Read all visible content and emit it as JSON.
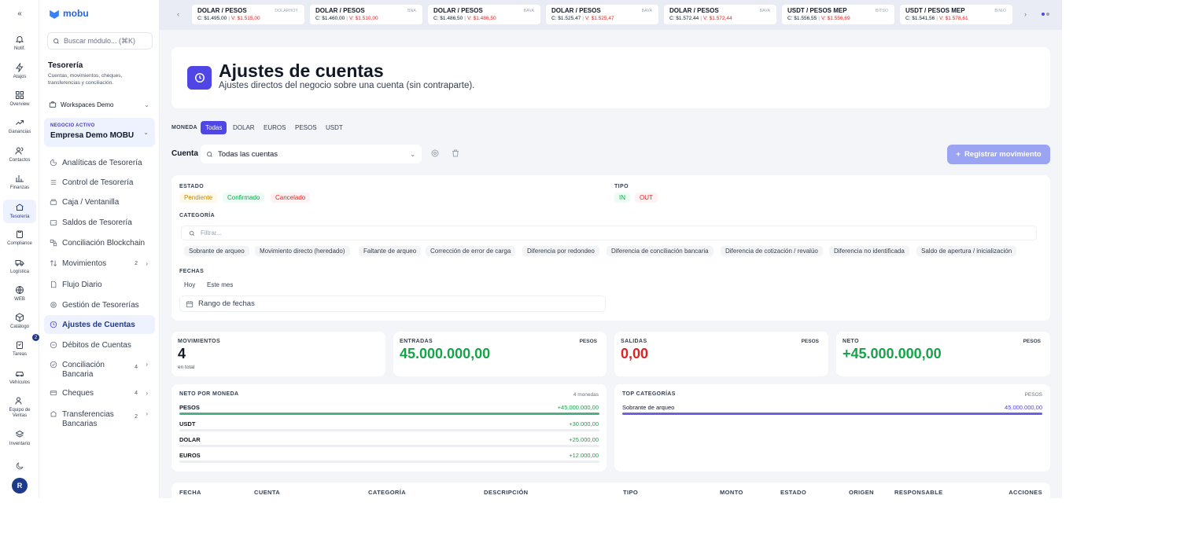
{
  "sidebar": {
    "brand": "mobu",
    "search_placeholder": "Buscar módulo... (⌘K)",
    "section_title": "Tesorería",
    "section_desc": "Cuentas, movimientos, cheques, transferencias y conciliación.",
    "workspace": "Workspaces Demo",
    "business_label": "NEGOCIO ACTIVO",
    "business_name": "Empresa Demo MOBU",
    "items": [
      {
        "label": "Analíticas de Tesorería"
      },
      {
        "label": "Control de Tesorería"
      },
      {
        "label": "Caja / Ventanilla"
      },
      {
        "label": "Saldos de Tesorería"
      },
      {
        "label": "Conciliación Blockchain"
      },
      {
        "label": "Movimientos",
        "count": "2"
      },
      {
        "label": "Flujo Diario"
      },
      {
        "label": "Gestión de Tesorerías"
      },
      {
        "label": "Ajustes de Cuentas"
      },
      {
        "label": "Débitos de Cuentas"
      },
      {
        "label": "Conciliación Bancaria",
        "count": "4"
      },
      {
        "label": "Cheques",
        "count": "4"
      },
      {
        "label": "Transferencias Bancarias",
        "count": "2"
      }
    ]
  },
  "rail": {
    "items": [
      "Notif.",
      "Atajos",
      "Overview",
      "Ganancias",
      "Contactos",
      "Finanzas",
      "Tesorería",
      "Compliance",
      "Logística",
      "WEB",
      "Catálogo",
      "Tareas",
      "Vehículos",
      "Equipo de Ventas",
      "Inventario"
    ],
    "tasks_badge": "2",
    "avatar": "R"
  },
  "ticker": [
    {
      "name": "DOLAR / PESOS",
      "source": "DOLARHOY",
      "buy": "C: $1.495,00",
      "sell": "V: $1.515,00"
    },
    {
      "name": "DOLAR / PESOS",
      "source": "BNA",
      "buy": "C: $1.460,00",
      "sell": "V: $1.510,00"
    },
    {
      "name": "DOLAR / PESOS",
      "source": "BAVA",
      "buy": "C: $1.486,50",
      "sell": "V: $1.486,50"
    },
    {
      "name": "DOLAR / PESOS",
      "source": "BAVA",
      "buy": "C: $1.525,47",
      "sell": "V: $1.525,47"
    },
    {
      "name": "DOLAR / PESOS",
      "source": "BAVA",
      "buy": "C: $1.572,44",
      "sell": "V: $1.572,44"
    },
    {
      "name": "USDT / PESOS MEP",
      "source": "BITSO",
      "buy": "C: $1.556,55",
      "sell": "V: $1.556,69"
    },
    {
      "name": "USDT / PESOS MEP",
      "source": "BINIO",
      "buy": "C: $1.541,56",
      "sell": "V: $1.578,61"
    }
  ],
  "hero": {
    "title": "Ajustes de cuentas",
    "subtitle": "Ajustes directos del negocio sobre una cuenta (sin contraparte)."
  },
  "currency": {
    "label": "MONEDA",
    "options": [
      "Todas",
      "DOLAR",
      "EUROS",
      "PESOS",
      "USDT"
    ]
  },
  "account": {
    "label": "Cuenta",
    "value": "Todas las cuentas",
    "register_label": "Registrar movimiento"
  },
  "filters": {
    "estado_label": "ESTADO",
    "estado": [
      "Pendiente",
      "Confirmado",
      "Cancelado"
    ],
    "tipo_label": "TIPO",
    "tipo": [
      "IN",
      "OUT"
    ],
    "categoria_label": "CATEGORÍA",
    "filter_placeholder": "Filtrar...",
    "categorias": [
      "Sobrante de arqueo",
      "Movimiento directo (heredado)",
      "Faltante de arqueo",
      "Corrección de error de carga",
      "Diferencia por redondeo",
      "Diferencia de conciliación bancaria",
      "Diferencia de cotización / revalúo",
      "Diferencia no identificada",
      "Saldo de apertura / inicialización"
    ],
    "fechas_label": "FECHAS",
    "fechas": [
      "Hoy",
      "Este mes"
    ],
    "rango": "Rango de fechas"
  },
  "stats": {
    "movimientos": {
      "label": "MOVIMIENTOS",
      "value": "4",
      "sub": "en total"
    },
    "entradas": {
      "label": "ENTRADAS",
      "currency": "PESOS",
      "value": "45.000.000,00"
    },
    "salidas": {
      "label": "SALIDAS",
      "currency": "PESOS",
      "value": "0,00"
    },
    "neto": {
      "label": "NETO",
      "currency": "PESOS",
      "value": "+45.000.000,00"
    }
  },
  "neto_moneda": {
    "title": "NETO POR MONEDA",
    "count": "4 monedas",
    "rows": [
      {
        "name": "PESOS",
        "value": "+45.000.000,00",
        "fill": 1.0
      },
      {
        "name": "USDT",
        "value": "+30.000,00",
        "fill": 0
      },
      {
        "name": "DOLAR",
        "value": "+25.000,00",
        "fill": 0
      },
      {
        "name": "EUROS",
        "value": "+12.000,00",
        "fill": 0
      }
    ]
  },
  "top_cat": {
    "title": "TOP CATEGORÍAS",
    "currency": "PESOS",
    "rows": [
      {
        "name": "Sobrante de arqueo",
        "value": "45.000.000,00",
        "fill": 1.0
      }
    ]
  },
  "table": {
    "headers": [
      "FECHA",
      "CUENTA",
      "CATEGORÍA",
      "DESCRIPCIÓN",
      "TIPO",
      "MONTO",
      "ESTADO",
      "ORIGEN",
      "RESPONSABLE",
      "ACCIONES"
    ]
  },
  "colors": {
    "accent": "#4f46e5",
    "positive": "#16a34a",
    "negative": "#dc2626",
    "pending": "#ca8a04",
    "bar_green": "#4caf87",
    "bar_purple": "#6d5fe6"
  }
}
